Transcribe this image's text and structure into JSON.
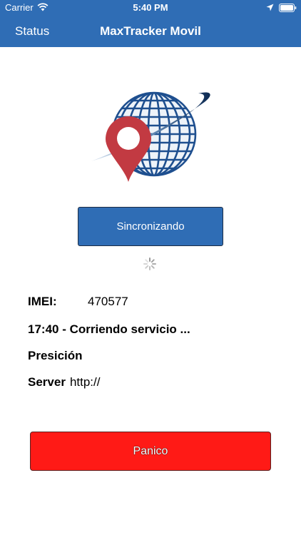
{
  "status_bar": {
    "carrier": "Carrier",
    "time": "5:40 PM",
    "icons": [
      "wifi-icon",
      "location-icon",
      "battery-icon"
    ]
  },
  "nav": {
    "back_label": "Status",
    "title": "MaxTracker Movil"
  },
  "logo": {
    "icons": [
      "globe-icon",
      "map-pin-icon"
    ]
  },
  "sync_button": {
    "label": "Sincronizando"
  },
  "info": {
    "imei_label": "IMEI:",
    "imei_value": "470577",
    "status_text": "17:40 - Corriendo servicio ...",
    "precision_label": "Presición",
    "server_label": "Server",
    "server_value": "http://"
  },
  "panic_button": {
    "label": "Panico"
  },
  "colors": {
    "header": "#2f6db5",
    "sync_button": "#2f6db5",
    "panic_button": "#ff1a16",
    "pin": "#c23a42",
    "globe": "#1e4f8f"
  }
}
